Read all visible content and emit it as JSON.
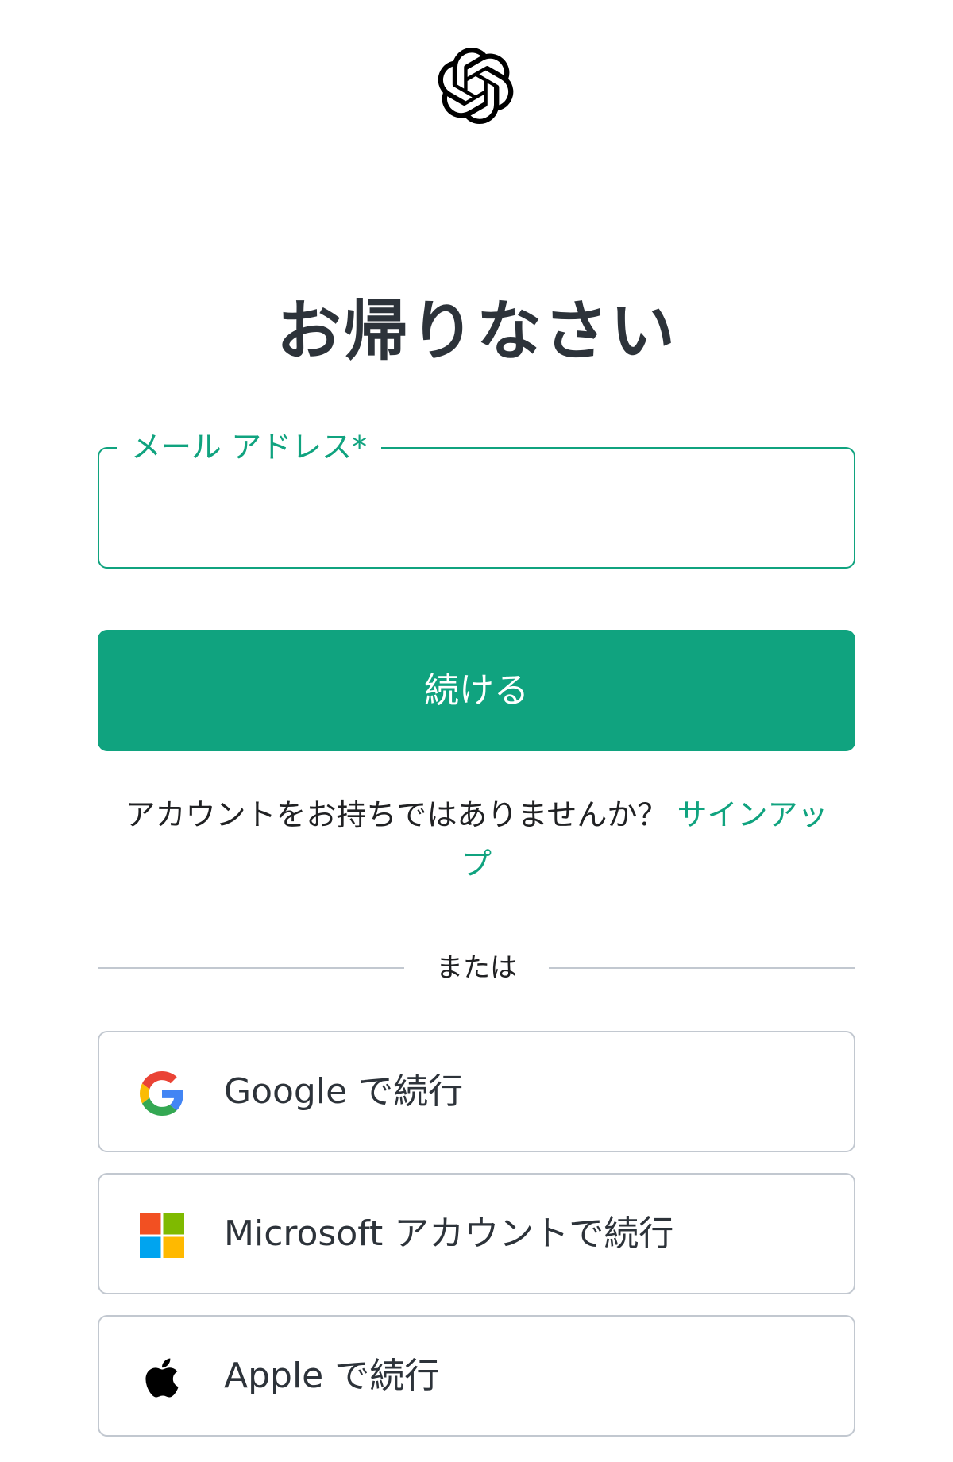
{
  "header": {
    "logo_icon": "openai-logo-icon"
  },
  "title": "お帰りなさい",
  "email": {
    "label": "メール アドレス*",
    "value": "",
    "placeholder": ""
  },
  "continue_button": {
    "label": "続ける"
  },
  "signup": {
    "prompt": "アカウントをお持ちではありませんか？ ",
    "link_label": "サインアップ"
  },
  "divider": {
    "label": "または"
  },
  "social": {
    "google": {
      "label": "Google で続行",
      "icon": "google-icon"
    },
    "microsoft": {
      "label": "Microsoft アカウントで続行",
      "icon": "microsoft-icon"
    },
    "apple": {
      "label": "Apple で続行",
      "icon": "apple-icon"
    }
  },
  "colors": {
    "accent": "#10a37f",
    "title_text": "#2d333a",
    "border": "#c2c8d0",
    "google_blue": "#4285F4",
    "google_red": "#EA4335",
    "google_yellow": "#FBBC05",
    "google_green": "#34A853",
    "ms_red": "#F25022",
    "ms_green": "#7FBA00",
    "ms_blue": "#00A4EF",
    "ms_yellow": "#FFB900"
  }
}
